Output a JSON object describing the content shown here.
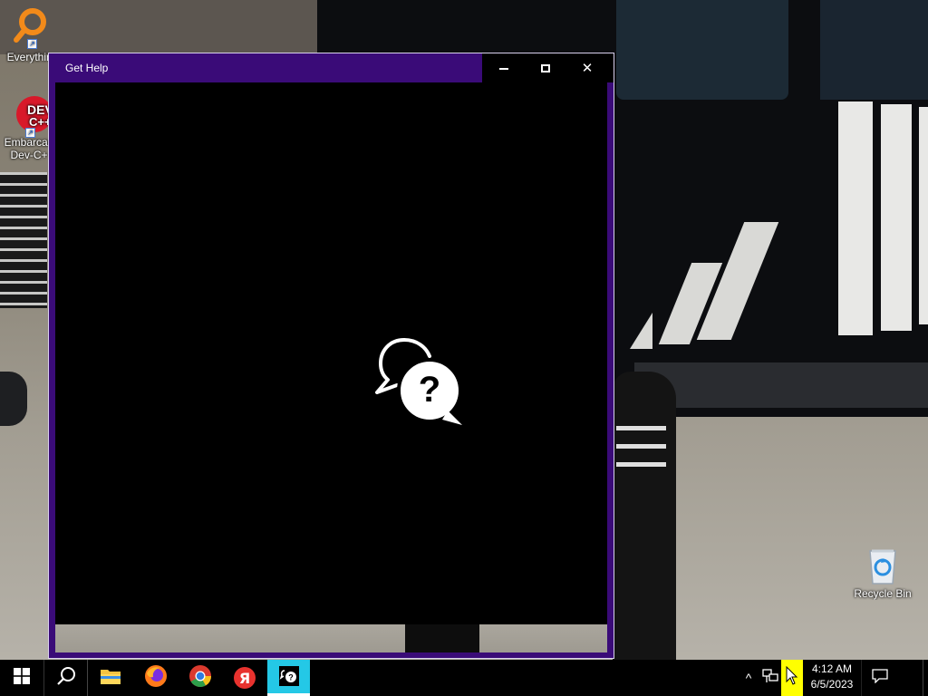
{
  "desktop": {
    "icons": [
      {
        "label": "Everything",
        "icon": "magnifier-icon"
      },
      {
        "label": "Embarcadero Dev-C++",
        "icon": "devcpp-icon",
        "line1": "Embarcad",
        "line2": "Dev-C+",
        "badge_top": "DEV",
        "badge_bottom": "C++"
      },
      {
        "label": "Recycle Bin",
        "icon": "recycle-bin-icon"
      }
    ]
  },
  "window": {
    "title": "Get Help",
    "controls": {
      "minimize": "minimize",
      "maximize": "maximize",
      "close": "close"
    },
    "splash_icon": "help-chat-bubble-icon",
    "splash_glyph": "?",
    "accent_color": "#3a0b78"
  },
  "taskbar": {
    "pinned": [
      {
        "name": "start",
        "icon": "windows-logo-icon"
      },
      {
        "name": "search",
        "icon": "search-icon"
      },
      {
        "name": "File Explorer",
        "icon": "folder-icon"
      },
      {
        "name": "Firefox",
        "icon": "firefox-icon"
      },
      {
        "name": "Chrome",
        "icon": "chrome-icon"
      },
      {
        "name": "Yandex",
        "icon": "yandex-icon",
        "glyph": "Я"
      },
      {
        "name": "Get Help",
        "icon": "get-help-icon",
        "active": true
      }
    ],
    "tray": {
      "chevron": "^",
      "time": "4:12 AM",
      "date": "6/5/2023",
      "highlight_color": "#ffff00"
    }
  }
}
